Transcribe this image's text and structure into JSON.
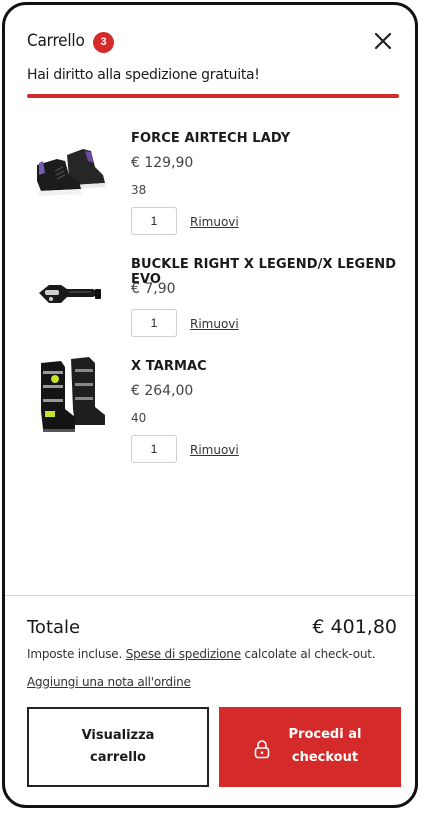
{
  "header": {
    "title": "Carrello",
    "count": "3"
  },
  "shipping": {
    "message": "Hai diritto alla spedizione gratuita!",
    "progress": 1.0
  },
  "colors": {
    "accent": "#d42a2a"
  },
  "items": [
    {
      "name": "FORCE AIRTECH LADY",
      "price": "€ 129,90",
      "size": "38",
      "qty": "1",
      "remove": "Rimuovi",
      "image": "sneaker-shoe"
    },
    {
      "name": "BUCKLE RIGHT X LEGEND/X LEGEND EVO",
      "price": "€ 7,90",
      "qty": "1",
      "remove": "Rimuovi",
      "image": "buckle"
    },
    {
      "name": "X TARMAC",
      "price": "€ 264,00",
      "size": "40",
      "qty": "1",
      "remove": "Rimuovi",
      "image": "motocross-boots"
    }
  ],
  "summary": {
    "total_label": "Totale",
    "total_value": "€ 401,80",
    "tax_prefix": "Imposte incluse. ",
    "tax_link": "Spese di spedizione",
    "tax_suffix": " calcolate al check-out.",
    "add_note": "Aggiungi una nota all'ordine"
  },
  "buttons": {
    "view_cart": "Visualizza carrello",
    "checkout": "Procedi al checkout"
  }
}
